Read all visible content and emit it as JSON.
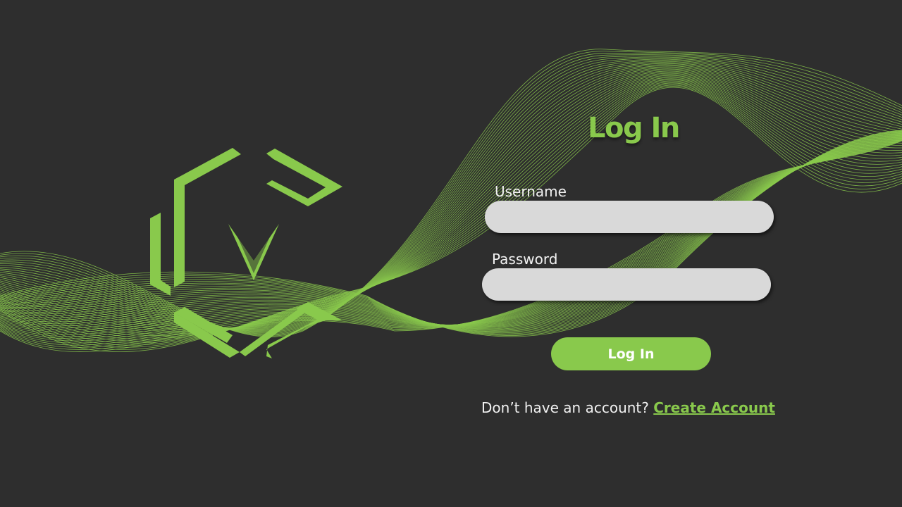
{
  "colors": {
    "background": "#2e2e2e",
    "accent": "#89c94c",
    "input_fill": "#d9d9d9",
    "text": "#f2f2f2"
  },
  "brand": {
    "logo_icon": "hexagonal-c-chevron-logo-icon"
  },
  "login": {
    "title": "Log In",
    "username_label": "Username",
    "username_value": "",
    "password_label": "Password",
    "password_value": "",
    "submit_label": "Log In"
  },
  "signup": {
    "prompt": "Don’t have an account?",
    "link_label": "Create Account"
  }
}
